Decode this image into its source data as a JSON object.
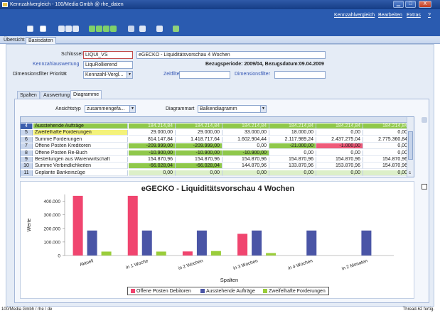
{
  "window": {
    "title": "Kennzahlvergleich - 100/Media Gmbh @ rhe_daten",
    "minimize": "▁",
    "maximize": "□",
    "close": "X"
  },
  "menu": {
    "items": [
      "Kennzahlvergleich",
      "Bearbeiten",
      "Extras",
      "?"
    ]
  },
  "tabs": [
    "Übersicht",
    "Basisdaten"
  ],
  "form": {
    "schluessel_label": "Schlüssel",
    "schluessel_value": "LIQUI_VS",
    "beschreibung_value": "eGECKO - Liquiditätsvorschau 4 Wochen",
    "auswertung_label": "Kennzahlauswertung",
    "auswertung_value": "LiquRollierend",
    "bezugsperiode": "Bezugsperiode: 2009/04, Bezugsdatum:09.04.2009",
    "dimfilter_label": "Dimensionsfilter Priorität",
    "dimfilter_value": "Kennzahl-Vergl...",
    "zeitfilter_label": "Zeitfilter",
    "dimensionsfilter_label": "Dimensionsfilter"
  },
  "subtabs": [
    "Spalten",
    "Auswertung",
    "Diagramme"
  ],
  "options": {
    "ansichtstyp_label": "Ansichtstyp",
    "ansichtstyp_value": "zusammengefa...",
    "diagrammart_label": "Diagrammart",
    "diagrammart_value": "Balkendiagramm"
  },
  "grid": {
    "rows": [
      {
        "num": "4",
        "label": "Ausstehende Aufträge",
        "values": [
          "184.214,84",
          "184.214,84",
          "184.214,84",
          "184.214,84",
          "184.214,84",
          "184.214,84"
        ]
      },
      {
        "num": "5",
        "label": "Zweifelhafte Forderungen",
        "values": [
          "29.000,00",
          "29.000,00",
          "33.000,00",
          "18.000,00",
          "0,00",
          "0,00"
        ]
      },
      {
        "num": "6",
        "label": "Summe Forderungen",
        "values": [
          "814.147,84",
          "1.418.717,64",
          "1.602.904,44",
          "2.117.989,24",
          "2.437.275,04",
          "2.775.360,84"
        ]
      },
      {
        "num": "7",
        "label": "Offene Posten Kreditoren",
        "values": [
          "-209.999,00",
          "-209.999,00",
          "0,00",
          "-21.000,00",
          "-1.000,00",
          "0,00"
        ]
      },
      {
        "num": "8",
        "label": "Offene Posten Re-Buch",
        "values": [
          "-10.900,00",
          "-10.900,00",
          "-10.900,00",
          "0,00",
          "0,00",
          "0,00"
        ]
      },
      {
        "num": "9",
        "label": "Bestellungen aus Warenwirtschaft",
        "values": [
          "154.870,96",
          "154.870,96",
          "154.870,96",
          "154.870,96",
          "154.870,96",
          "154.870,96"
        ]
      },
      {
        "num": "10",
        "label": "Summe Verbindlichkeiten",
        "values": [
          "-66.028,04",
          "-66.028,04",
          "144.870,96",
          "133.870,96",
          "153.870,96",
          "154.870,96"
        ]
      },
      {
        "num": "11",
        "label": "Geplante Bankeinzüge",
        "values": [
          "0,00",
          "0,00",
          "0,00",
          "0,00",
          "0,00",
          "0,00"
        ]
      }
    ],
    "scroll_marker": "c"
  },
  "chart_data": {
    "type": "bar",
    "title": "eGECKO - Liquiditätsvorschau 4 Wochen",
    "xlabel": "Spalten",
    "ylabel": "Werte",
    "ylim": [
      0,
      450000
    ],
    "yticks": [
      "0",
      "100.000",
      "200.000",
      "300.000",
      "400.000"
    ],
    "ytick_values": [
      0,
      100000,
      200000,
      300000,
      400000
    ],
    "categories": [
      "Aktuell",
      "in 1 Woche",
      "in 2 Wochen",
      "in 3 Wochen",
      "in 4 Wochen",
      "in 2 Monaten"
    ],
    "series": [
      {
        "name": "Offene Posten Debitoren",
        "color": "#f0456f",
        "values": [
          440000,
          440000,
          30000,
          160000,
          0,
          0
        ]
      },
      {
        "name": "Ausstehende Aufträge",
        "color": "#4a55a6",
        "values": [
          184214,
          184214,
          184214,
          184214,
          184214,
          184214
        ]
      },
      {
        "name": "Zweifelhafte Forderungen",
        "color": "#9acd3a",
        "values": [
          29000,
          29000,
          33000,
          18000,
          0,
          0
        ]
      }
    ],
    "grid": false,
    "legend_position": "bottom"
  },
  "status": {
    "left": "100/Media Gmbh / rhe / de",
    "right": "Thread-62 fertig."
  },
  "colors": {
    "row_green": "#8fc84a",
    "row_yellow": "#f4f27a",
    "row_red": "#ef5a79",
    "row_teal": "#7fb8a6",
    "header_blue": "#2a5bb0"
  }
}
